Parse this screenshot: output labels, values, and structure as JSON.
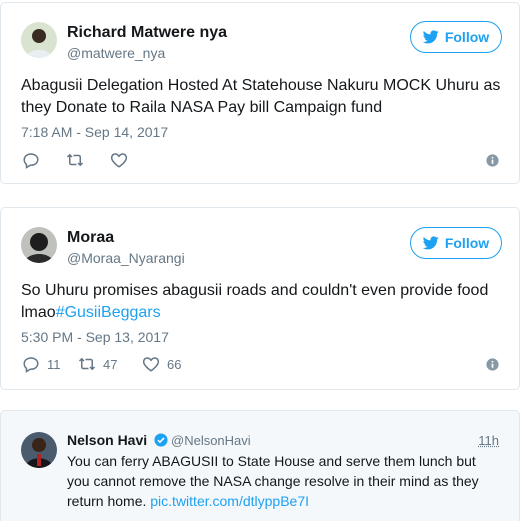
{
  "tweets": [
    {
      "name": "Richard Matwere nya",
      "handle": "@matwere_nya",
      "follow_label": "Follow",
      "text": "Abagusii Delegation Hosted At Statehouse Nakuru MOCK Uhuru as they Donate to Raila NASA Pay bill Campaign fund",
      "timestamp": "7:18 AM - Sep 14, 2017",
      "replies": "",
      "retweets": "",
      "likes": ""
    },
    {
      "name": "Moraa",
      "handle": "@Moraa_Nyarangi",
      "follow_label": "Follow",
      "text": "So Uhuru promises abagusii roads and couldn't even provide food lmao",
      "hashtag": "#GusiiBeggars",
      "timestamp": "5:30 PM - Sep 13, 2017",
      "replies": "11",
      "retweets": "47",
      "likes": "66"
    }
  ],
  "quoted": {
    "name": "Nelson Havi",
    "handle": "@NelsonHavi",
    "time": "11h",
    "text": "You can ferry ABAGUSII to State House and serve them lunch but you cannot remove the NASA change resolve in their mind as they return home.",
    "link": "pic.twitter.com/dtlyppBe7I"
  },
  "colors": {
    "accent": "#1da1f2",
    "muted": "#657786",
    "border": "#e1e8ed"
  },
  "icons": [
    "twitter-bird-icon",
    "reply-icon",
    "retweet-icon",
    "heart-icon",
    "info-icon",
    "verified-badge-icon"
  ]
}
